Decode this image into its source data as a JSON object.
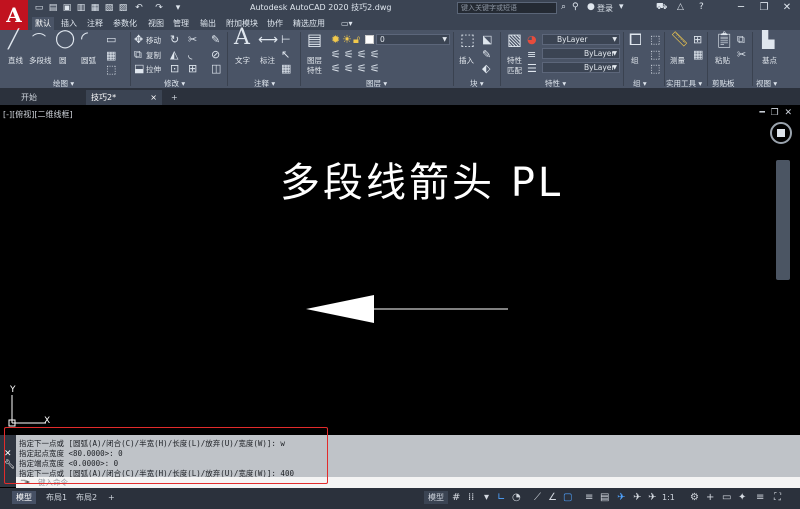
{
  "app": {
    "logo": "A",
    "window_title": "Autodesk AutoCAD 2020    技巧2.dwg",
    "search_placeholder": "键入关键字或短语",
    "login_label": "登录"
  },
  "ribbon_tabs": [
    "默认",
    "插入",
    "注释",
    "参数化",
    "视图",
    "管理",
    "输出",
    "附加模块",
    "协作",
    "精选应用"
  ],
  "ribbon": {
    "draw": {
      "line": "直线",
      "polyline": "多段线",
      "circle": "圆",
      "arc": "圆弧",
      "title": "绘图 ▾"
    },
    "modify": {
      "move": "移动",
      "copy": "复制",
      "stretch": "拉伸",
      "title": "修改 ▾"
    },
    "annotation": {
      "text": "文字",
      "dimension": "标注",
      "title": "注释 ▾"
    },
    "layers": {
      "layer_props": "图层\n特性",
      "current_layer": "0",
      "title": "图层 ▾"
    },
    "block": {
      "insert": "插入",
      "title": "块 ▾"
    },
    "properties": {
      "match": "特性\n匹配",
      "color": "ByLayer",
      "linetype": "ByLayer",
      "lineweight": "ByLayer",
      "title": "特性 ▾"
    },
    "groups": {
      "group": "组",
      "title": "组 ▾"
    },
    "utilities": {
      "measure": "测量",
      "title": "实用工具 ▾"
    },
    "clipboard": {
      "paste": "粘贴",
      "title": "剪贴板"
    },
    "view": {
      "base": "基点",
      "title": "视图 ▾"
    }
  },
  "doc_tabs": {
    "start": "开始",
    "drawing": "技巧2*",
    "close": "×",
    "add": "+"
  },
  "canvas": {
    "view_label": "[-][俯视][二维线框]",
    "heading": "多段线箭头   PL",
    "ucs_y": "Y",
    "ucs_x": "X"
  },
  "command": {
    "history": [
      "指定下一点或 [圆弧(A)/闭合(C)/半宽(H)/长度(L)/放弃(U)/宽度(W)]: w",
      "指定起点宽度 <80.0000>: 0",
      "指定端点宽度 <0.0000>: 0",
      "指定下一点或 [圆弧(A)/闭合(C)/半宽(H)/长度(L)/放弃(U)/宽度(W)]: 400"
    ],
    "input_placeholder": "键入命令"
  },
  "status": {
    "tabs": [
      "模型",
      "布局1",
      "布局2"
    ],
    "add": "+",
    "model_space": "模型",
    "scale": "1:1"
  },
  "colors": {
    "accent_red": "#e22b2b",
    "logo_red": "#c1121f",
    "status_on": "#4fa3ff"
  }
}
